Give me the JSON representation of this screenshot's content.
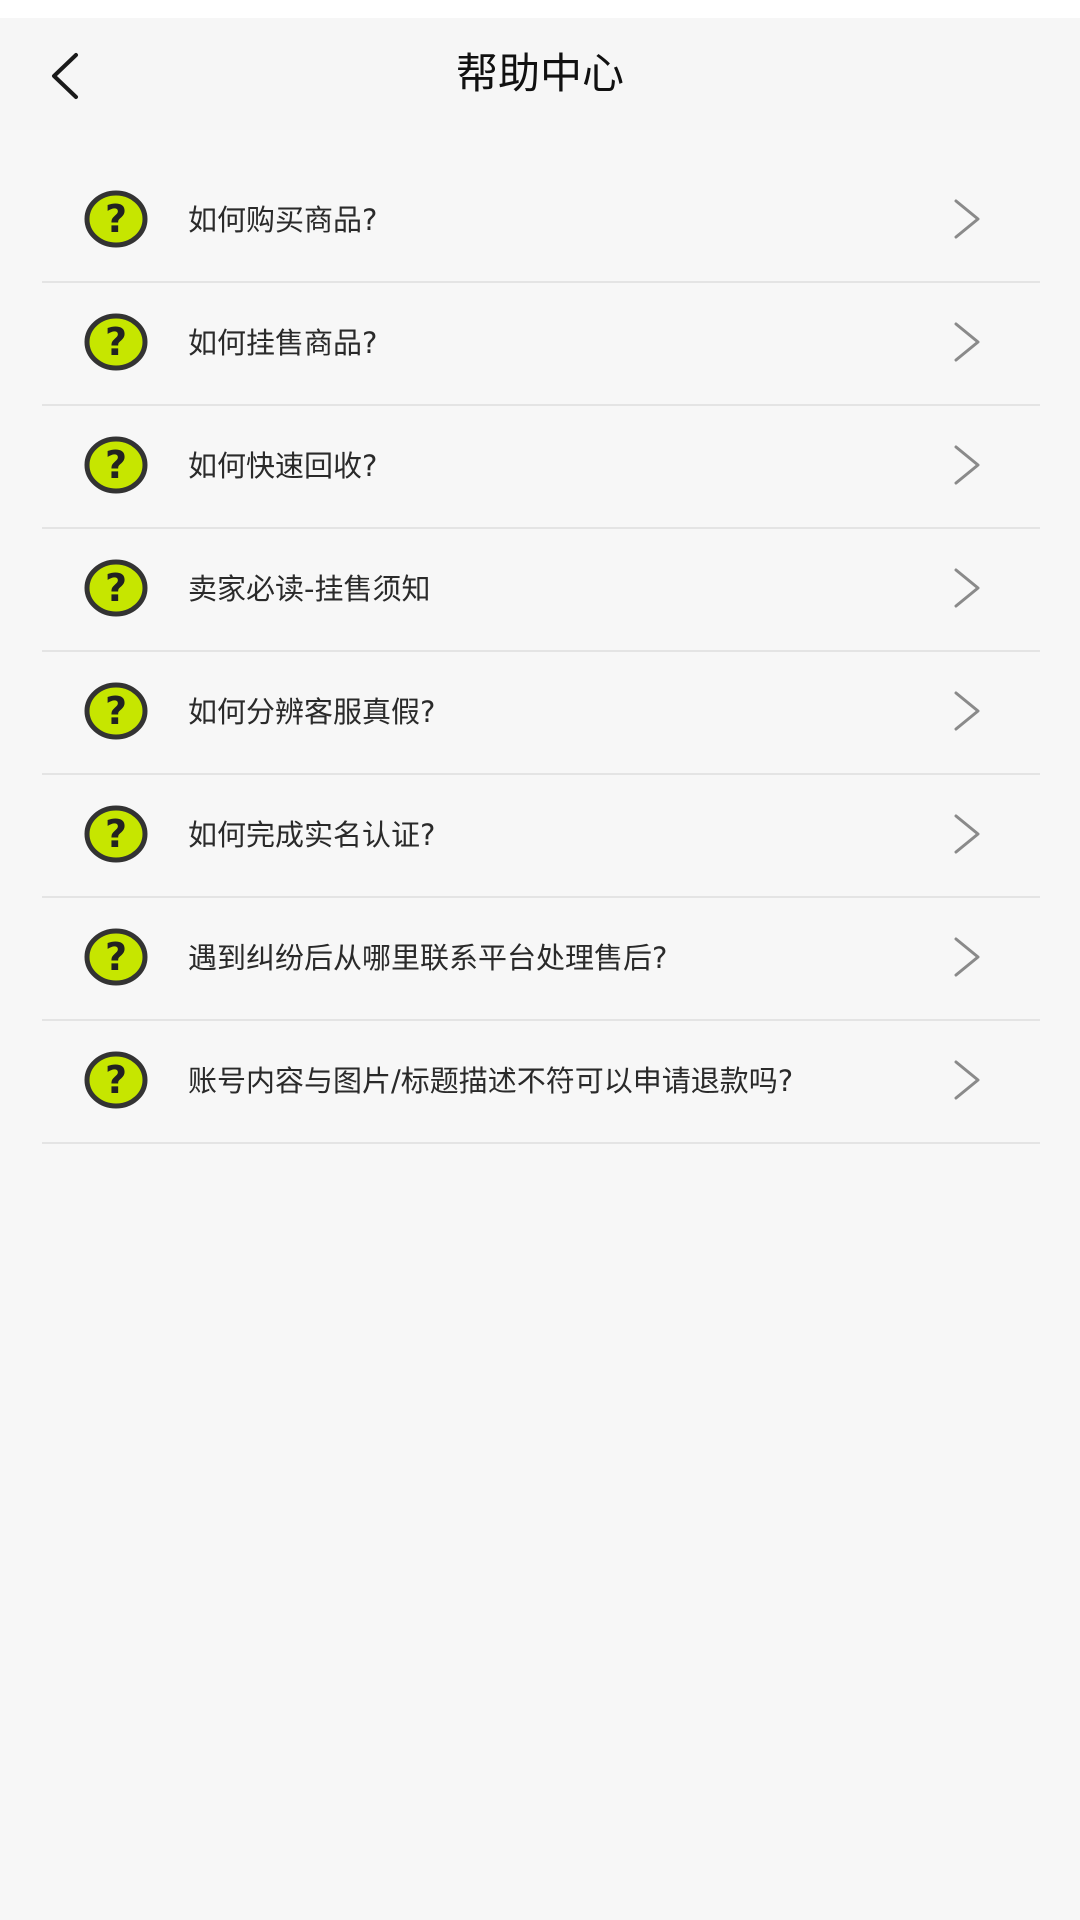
{
  "header": {
    "title": "帮助中心",
    "back_icon": "chevron-left-icon"
  },
  "help_items": [
    {
      "label": "如何购买商品?"
    },
    {
      "label": "如何挂售商品?"
    },
    {
      "label": "如何快速回收?"
    },
    {
      "label": "卖家必读-挂售须知"
    },
    {
      "label": "如何分辨客服真假?"
    },
    {
      "label": "如何完成实名认证?"
    },
    {
      "label": "遇到纠纷后从哪里联系平台处理售后?"
    },
    {
      "label": "账号内容与图片/标题描述不符可以申请退款吗?"
    }
  ],
  "icons": {
    "item_icon": "question-mark-icon",
    "item_arrow": "chevron-right-icon"
  },
  "colors": {
    "background": "#f7f7f7",
    "icon_fill": "#c6e600",
    "icon_outline": "#333333",
    "divider": "#e4e4e4",
    "chevron": "#8a8a8a"
  }
}
